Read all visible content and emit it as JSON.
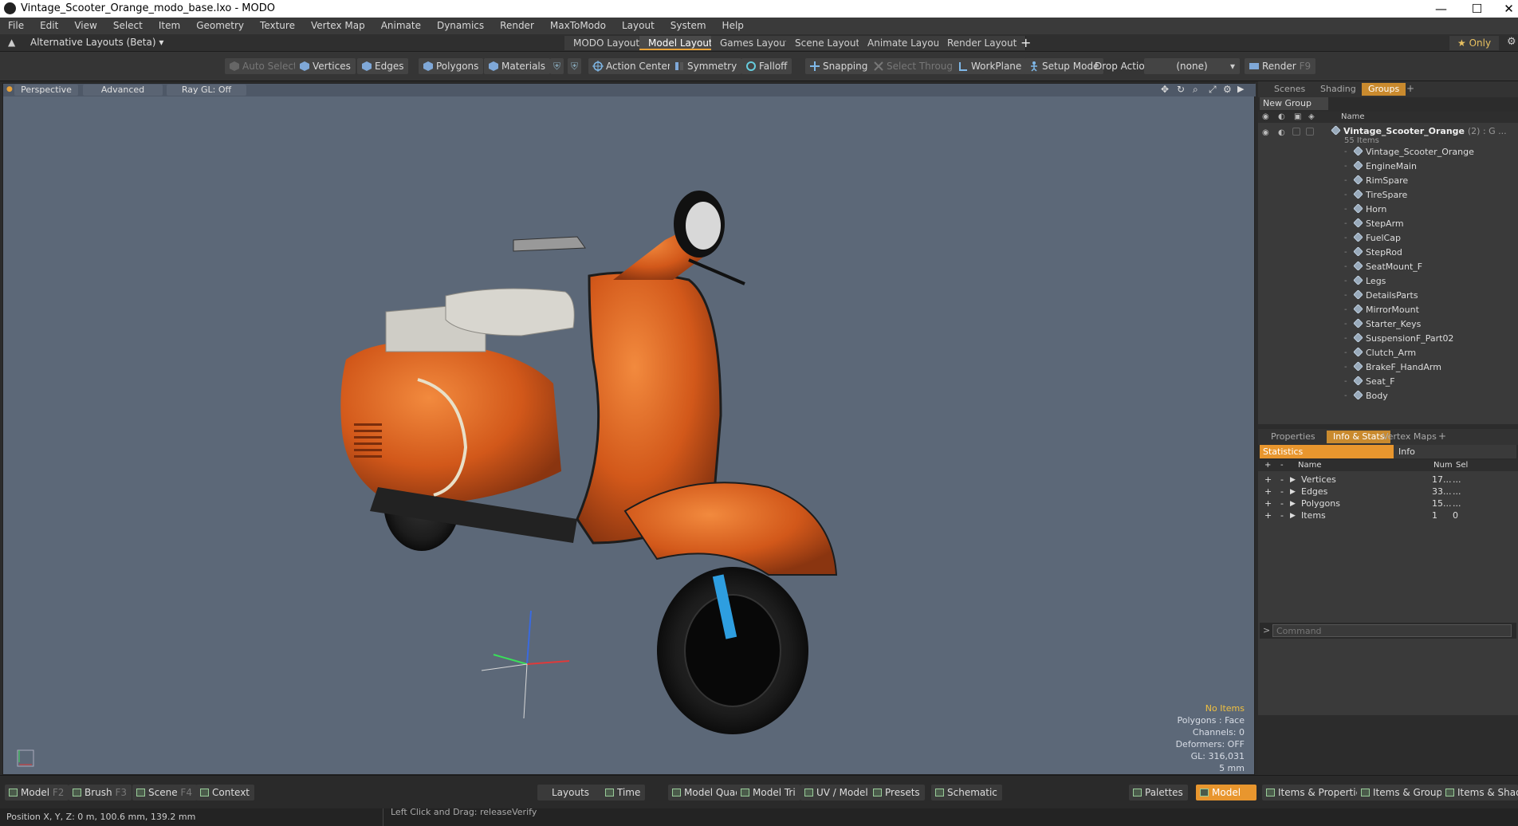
{
  "window": {
    "title": "Vintage_Scooter_Orange_modo_base.lxo - MODO",
    "minimize": "—",
    "maximize": "☐",
    "close": "✕"
  },
  "menu": [
    "File",
    "Edit",
    "View",
    "Select",
    "Item",
    "Geometry",
    "Texture",
    "Vertex Map",
    "Animate",
    "Dynamics",
    "Render",
    "MaxToModo",
    "Layout",
    "System",
    "Help"
  ],
  "layout_bar": {
    "alt_layouts": "Alternative Layouts (Beta) ▾",
    "tabs": [
      "MODO Layout",
      "Model Layout",
      "Games Layout",
      "Scene Layout",
      "Animate Layout",
      "Render Layout"
    ],
    "active_tab": "Model Layout",
    "add": "+",
    "only": "★ Only"
  },
  "toolbar": {
    "auto_select": "Auto Select",
    "vertices": "Vertices",
    "edges": "Edges",
    "polygons": "Polygons",
    "materials": "Materials",
    "action_center": "Action Center",
    "symmetry": "Symmetry",
    "falloff": "Falloff",
    "snapping": "Snapping",
    "select_through": "Select Through",
    "workplane": "WorkPlane",
    "setup_mode": "Setup Mode",
    "drop_action": "Drop Action",
    "drop_value": "(none)",
    "render": "Render",
    "render_key": "F9"
  },
  "viewport": {
    "perspective": "Perspective",
    "advanced": "Advanced",
    "raygl": "Ray GL: Off",
    "info": {
      "no_items": "No Items",
      "polygons": "Polygons : Face",
      "channels": "Channels: 0",
      "deformers": "Deformers: OFF",
      "gl": "GL: 316,031",
      "scale": "5 mm"
    }
  },
  "groups_panel": {
    "tabs": [
      "Scenes",
      "Shading",
      "Groups"
    ],
    "active_tab": "Groups",
    "new_group": "New Group",
    "name_header": "Name",
    "group_name": "Vintage_Scooter_Orange",
    "group_suffix": "(2) : G ...",
    "item_count": "55 Items",
    "items": [
      "Vintage_Scooter_Orange",
      "EngineMain",
      "RimSpare",
      "TireSpare",
      "Horn",
      "StepArm",
      "FuelCap",
      "StepRod",
      "SeatMount_F",
      "Legs",
      "DetailsParts",
      "MirrorMount",
      "Starter_Keys",
      "SuspensionF_Part02",
      "Clutch_Arm",
      "BrakeF_HandArm",
      "Seat_F",
      "Body"
    ]
  },
  "stats_panel": {
    "tabs": [
      "Properties",
      "Info & Stats",
      "Vertex Maps"
    ],
    "active_tab": "Info & Stats",
    "sub_tabs": [
      "Statistics",
      "Info"
    ],
    "headers": {
      "name": "Name",
      "num": "Num",
      "sel": "Sel"
    },
    "rows": [
      {
        "name": "Vertices",
        "num": "17...",
        "sel": "..."
      },
      {
        "name": "Edges",
        "num": "33...",
        "sel": "..."
      },
      {
        "name": "Polygons",
        "num": "15...",
        "sel": "..."
      },
      {
        "name": "Items",
        "num": "1",
        "sel": "0"
      }
    ],
    "command_placeholder": "Command"
  },
  "statusbar": {
    "left": [
      {
        "label": "Model",
        "key": "F2"
      },
      {
        "label": "Brush",
        "key": "F3"
      },
      {
        "label": "Scene",
        "key": "F4"
      },
      {
        "label": "Context",
        "key": ""
      }
    ],
    "center": [
      "Layouts",
      "Time",
      "Model Quad",
      "Model Tri",
      "UV / Model",
      "Presets",
      "Schematic"
    ],
    "right": [
      "Palettes",
      "Model",
      "Items & Properties",
      "Items & Groups",
      "Items & Shading"
    ]
  },
  "infobar": {
    "position": "Position X, Y, Z:   0 m, 100.6 mm, 139.2 mm",
    "hint": "Left Click and Drag:  releaseVerify"
  },
  "colors": {
    "accent": "#e8962e",
    "viewport": "#5c6878",
    "scooter": "#d9641e"
  }
}
